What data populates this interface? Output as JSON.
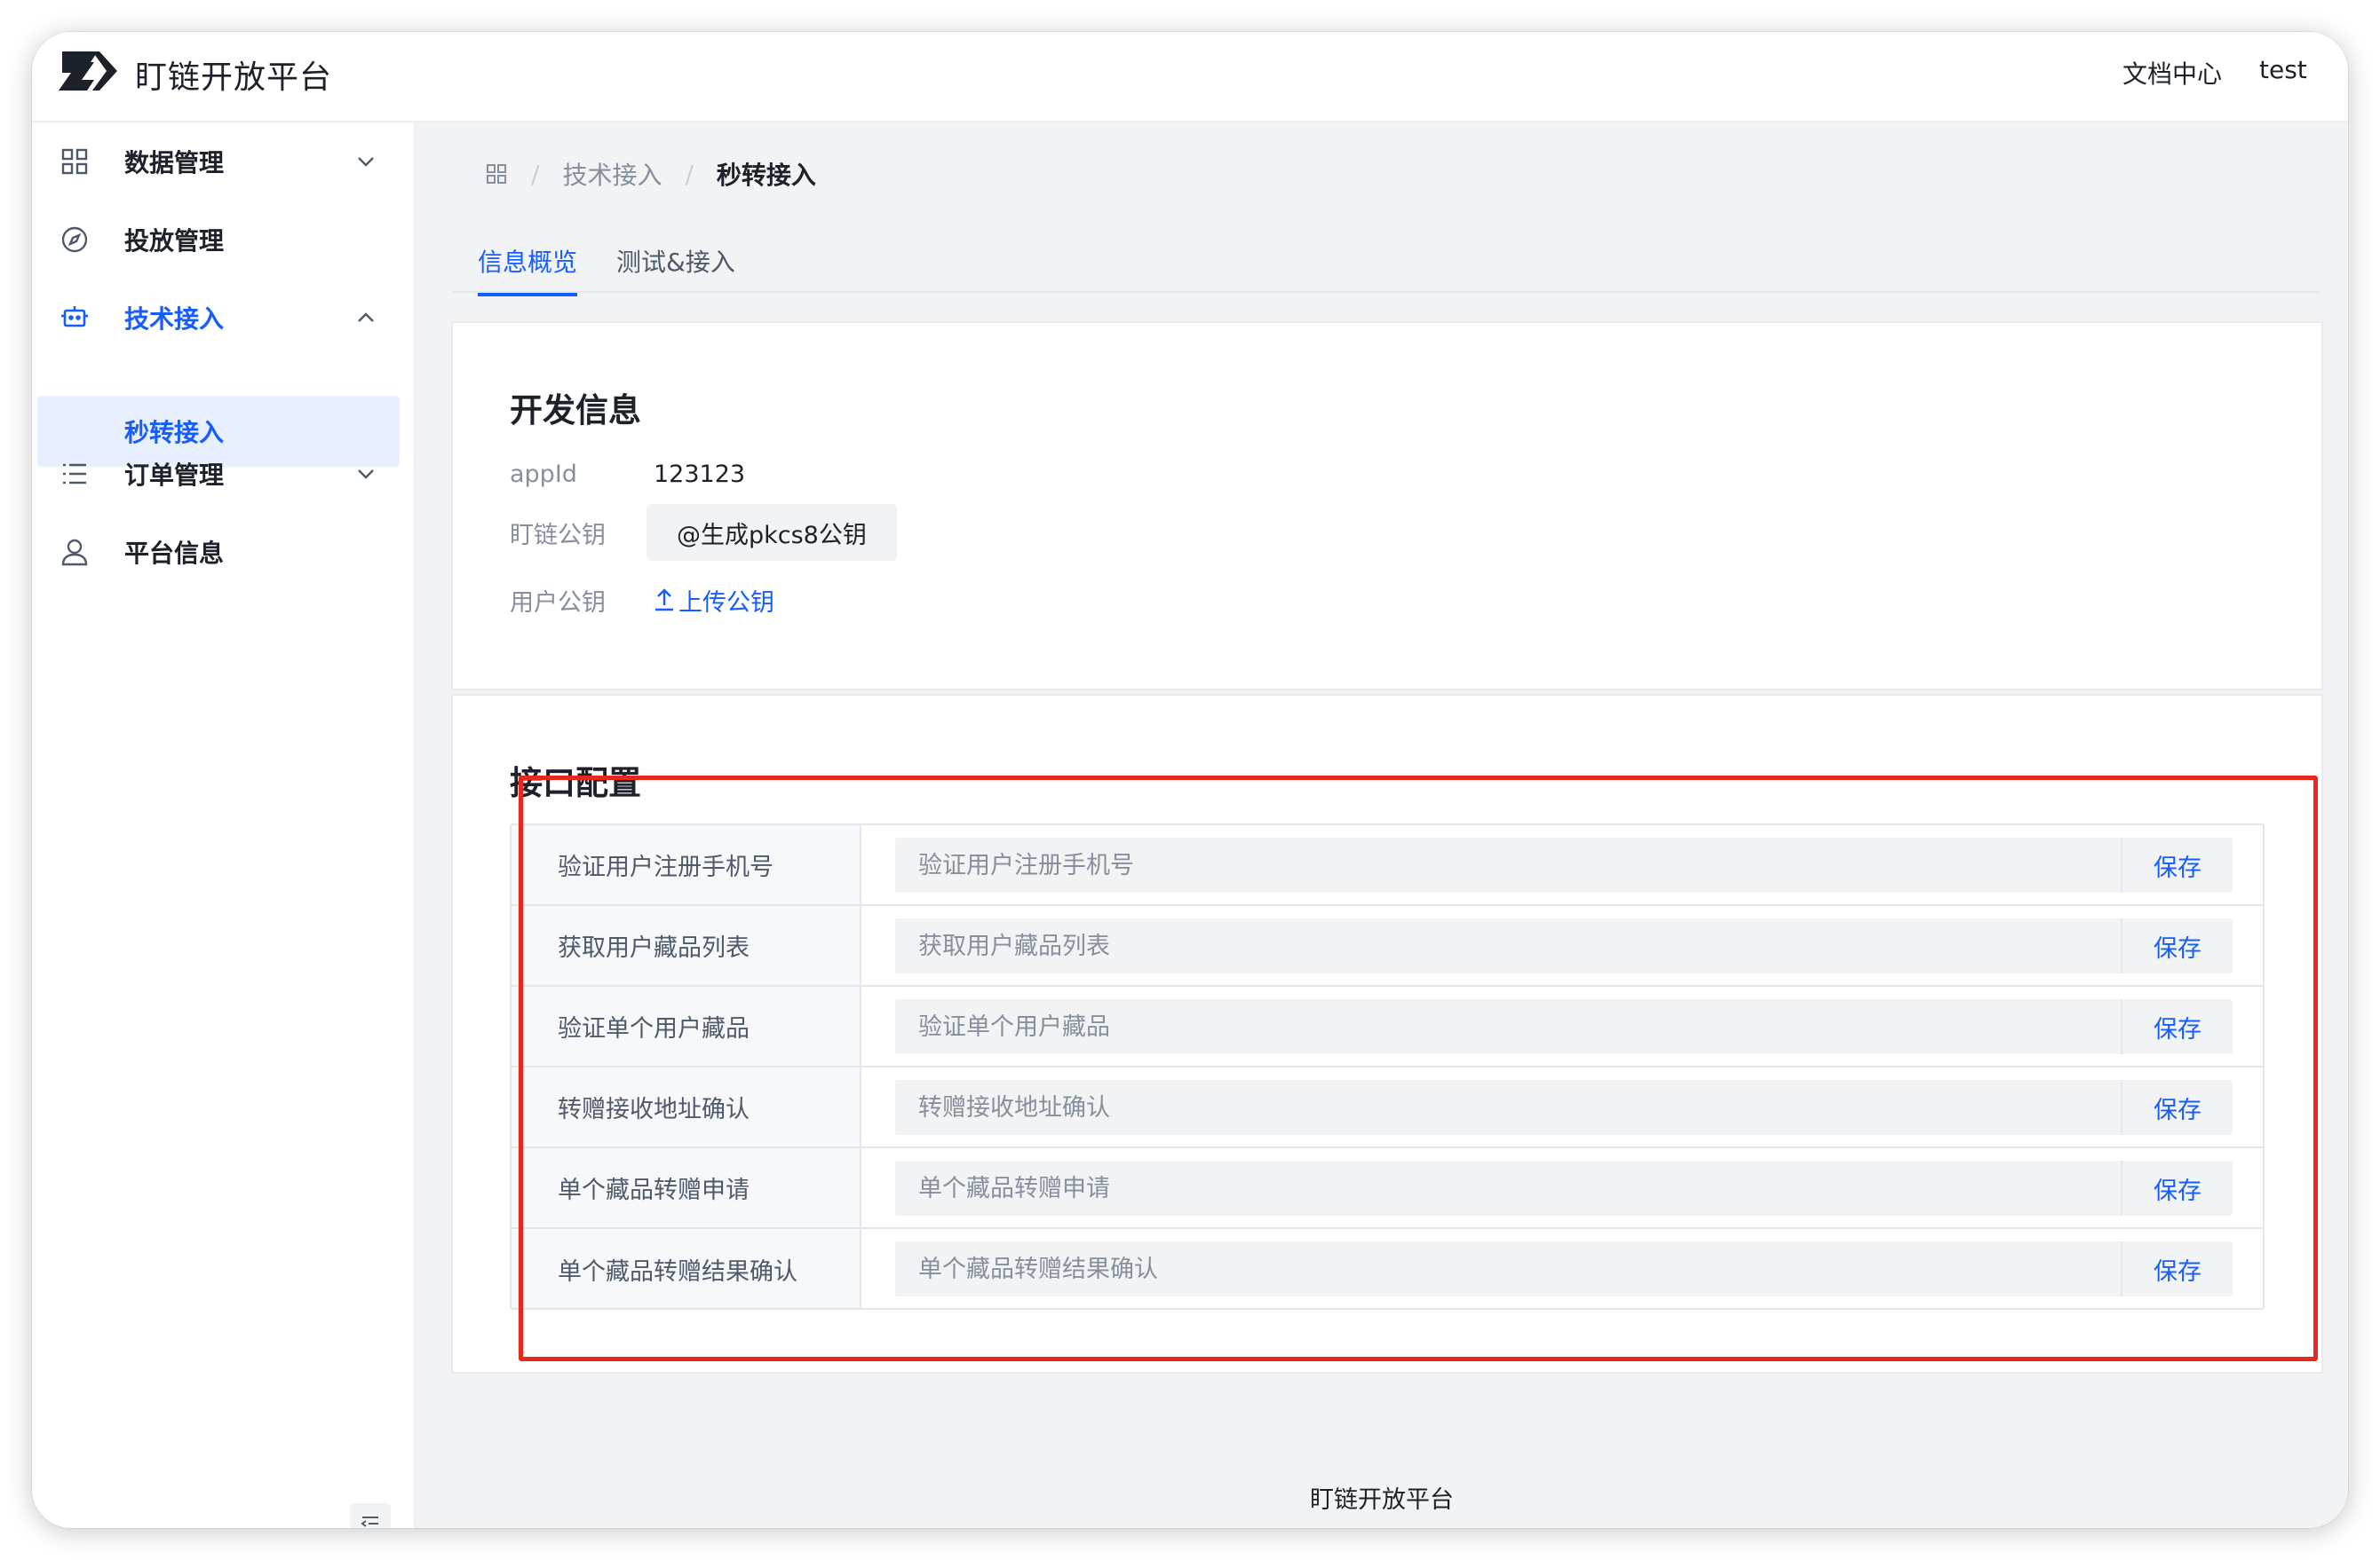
{
  "header": {
    "brand": "盯链开放平台",
    "docs_link": "文档中心",
    "user": "test"
  },
  "sidebar": {
    "items": [
      {
        "label": "数据管理",
        "icon": "grid-icon",
        "expanded": false
      },
      {
        "label": "投放管理",
        "icon": "compass-icon"
      },
      {
        "label": "技术接入",
        "icon": "robot-icon",
        "expanded": true
      },
      {
        "label": "秒转接入",
        "selected": true
      },
      {
        "label": "订单管理",
        "icon": "list-icon",
        "expanded": false
      },
      {
        "label": "平台信息",
        "icon": "user-icon"
      }
    ]
  },
  "breadcrumb": {
    "parent": "技术接入",
    "current": "秒转接入"
  },
  "tabs": [
    {
      "label": "信息概览",
      "active": true
    },
    {
      "label": "测试&接入",
      "active": false
    }
  ],
  "dev_info": {
    "title": "开发信息",
    "appid_label": "appId",
    "appid_value": "123123",
    "platform_key_label": "盯链公钥",
    "platform_key_button": "@生成pkcs8公钥",
    "user_key_label": "用户公钥",
    "upload_link": "上传公钥"
  },
  "api_config": {
    "title": "接口配置",
    "save_label": "保存",
    "rows": [
      {
        "label": "验证用户注册手机号",
        "placeholder": "验证用户注册手机号",
        "value": ""
      },
      {
        "label": "获取用户藏品列表",
        "placeholder": "获取用户藏品列表",
        "value": ""
      },
      {
        "label": "验证单个用户藏品",
        "placeholder": "验证单个用户藏品",
        "value": ""
      },
      {
        "label": "转赠接收地址确认",
        "placeholder": "转赠接收地址确认",
        "value": ""
      },
      {
        "label": "单个藏品转赠申请",
        "placeholder": "单个藏品转赠申请",
        "value": ""
      },
      {
        "label": "单个藏品转赠结果确认",
        "placeholder": "单个藏品转赠结果确认",
        "value": ""
      }
    ]
  },
  "footer": "盯链开放平台",
  "colors": {
    "accent": "#165dff",
    "highlight": "#e8281a"
  }
}
